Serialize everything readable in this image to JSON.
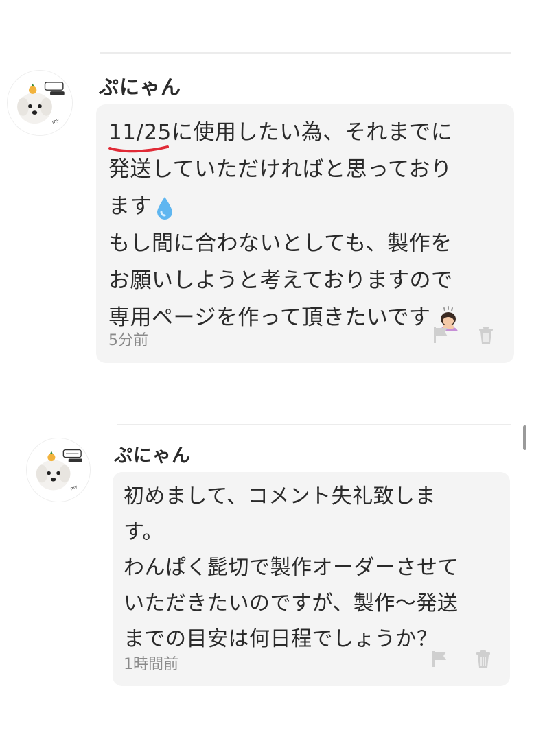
{
  "comments": [
    {
      "username": "ぷにゃん",
      "lines": [
        "11/25に使用したい為、それまでに",
        "発送していただければと思っており",
        "ます",
        "もし間に合わないとしても、製作を",
        "お願いしようと考えておりますので",
        "専用ページを作って頂きたいです"
      ],
      "underlined_text": "11/25",
      "timestamp": "5分前",
      "emojis": [
        "droplet-emoji",
        "bowing-person-emoji"
      ]
    },
    {
      "username": "ぷにゃん",
      "lines": [
        "初めまして、コメント失礼致しま",
        "す。",
        "わんぱく髭切で製作オーダーさせて",
        "いただきたいのですが、製作〜発送",
        "までの目安は何日程でしょうか？"
      ],
      "timestamp": "1時間前"
    }
  ],
  "icons": {
    "flag": "flag-icon",
    "trash": "trash-icon"
  },
  "colors": {
    "bubble_bg": "#f4f4f4",
    "underline": "#e02a36",
    "icon_gray": "#cfcfcf"
  }
}
